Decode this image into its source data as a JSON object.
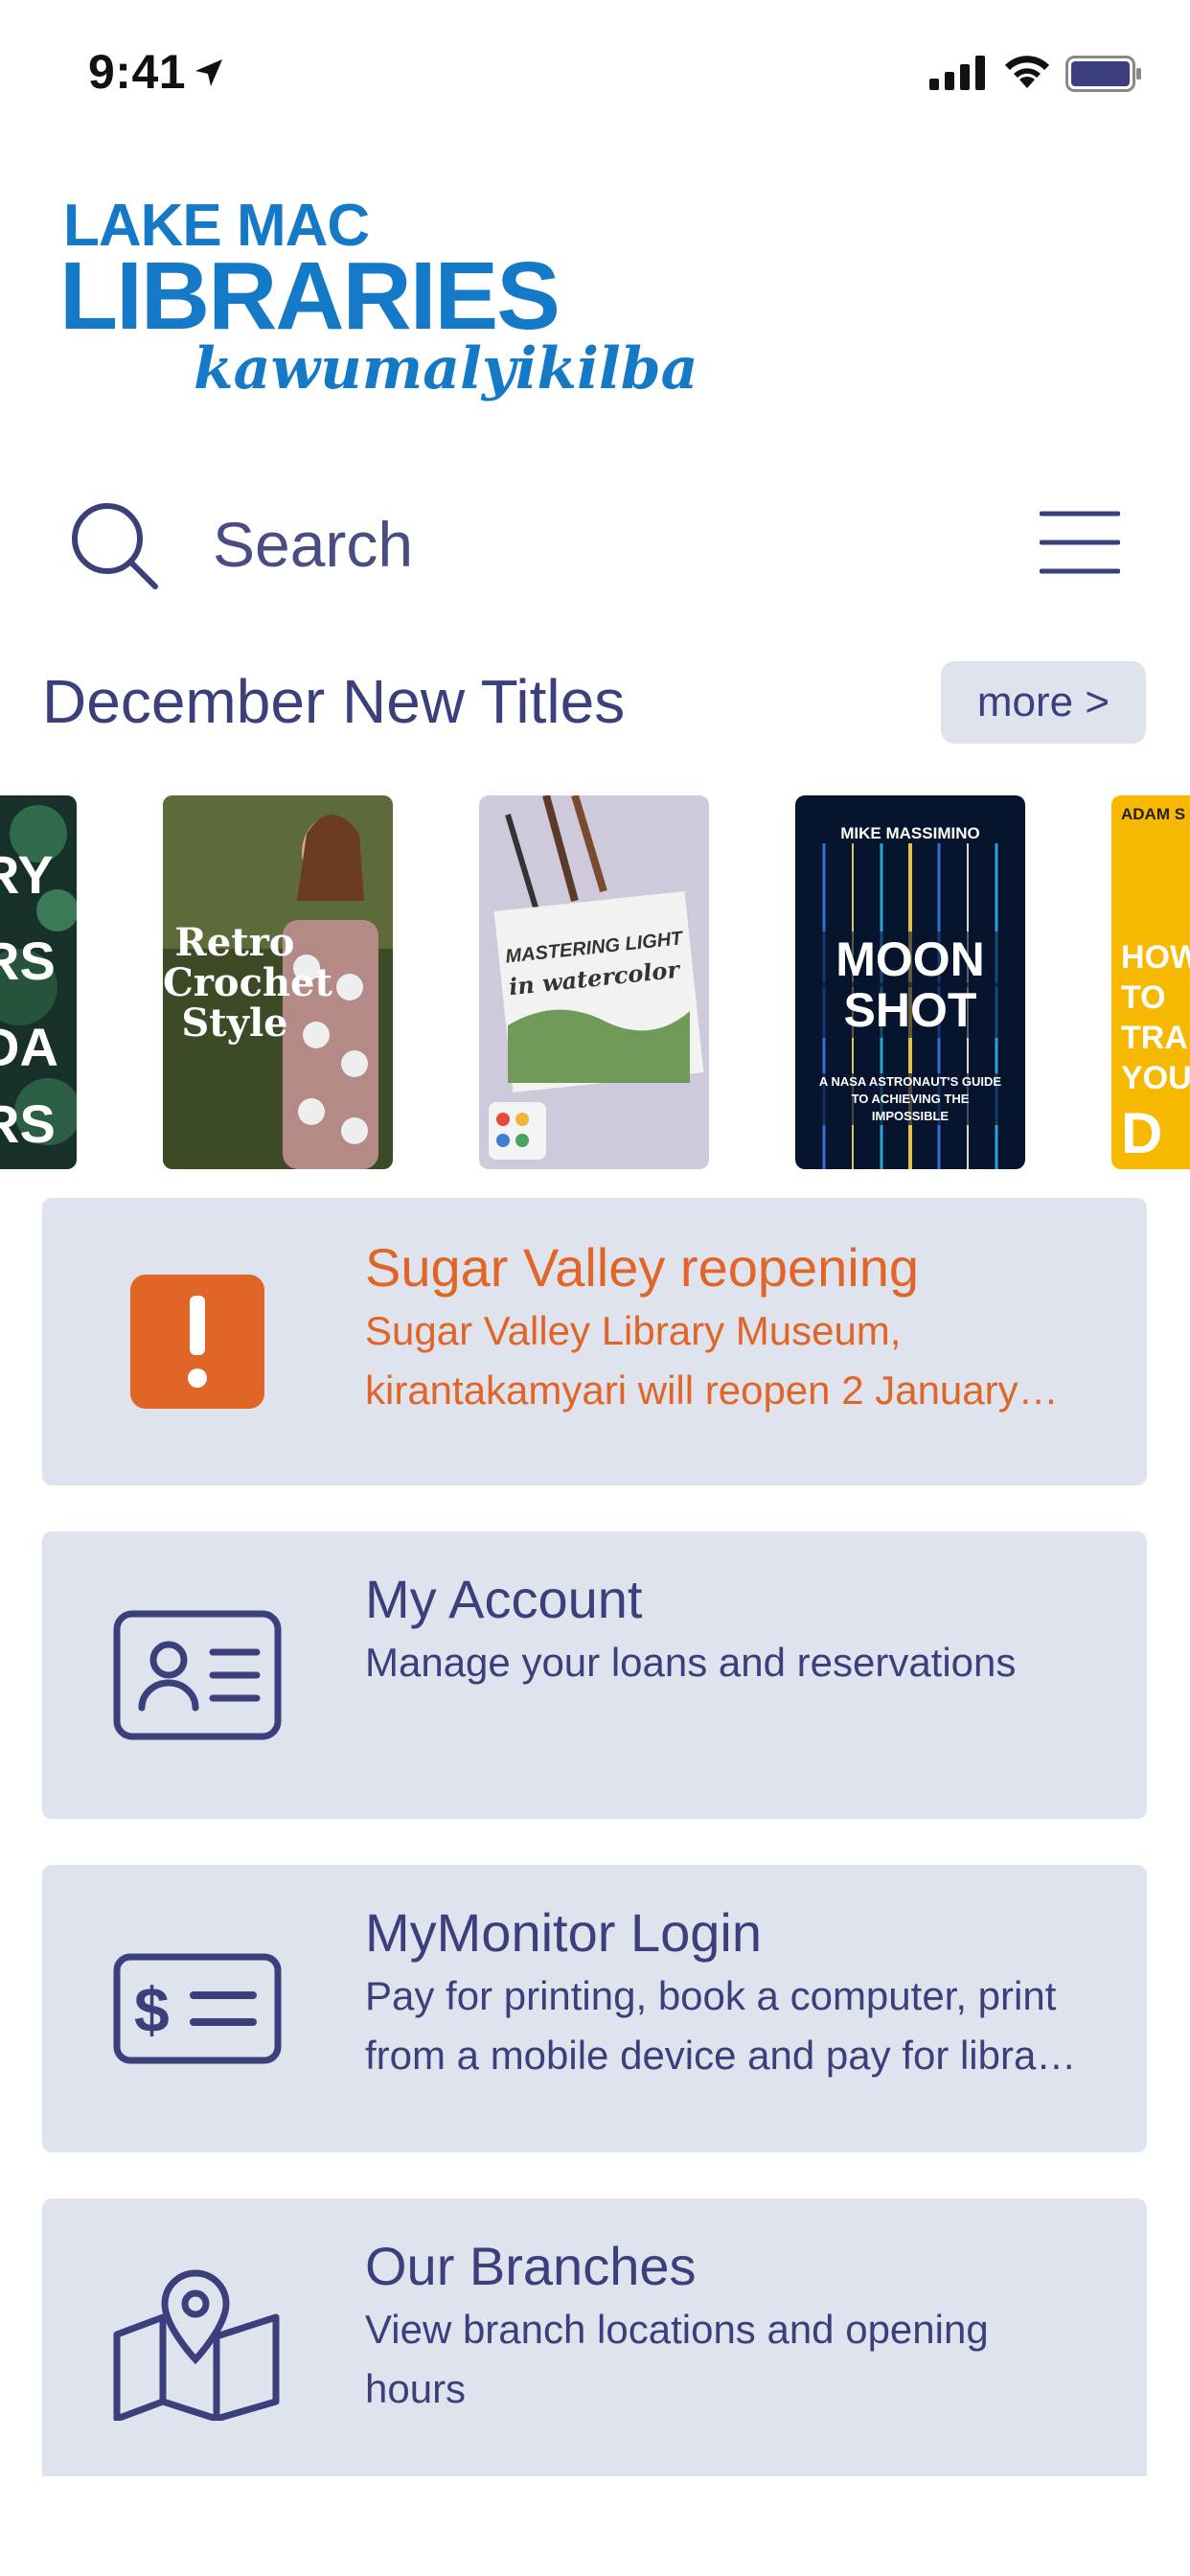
{
  "status_bar": {
    "time": "9:41"
  },
  "logo": {
    "line1": "LAKE MAC",
    "line2": "LIBRARIES",
    "line3": "kawumalyikilba"
  },
  "search": {
    "placeholder": "Search"
  },
  "section": {
    "title": "December New Titles",
    "more_label": "more >"
  },
  "books": [
    {
      "cover_lines": [
        "RY",
        "RS",
        "DA",
        "RS"
      ]
    },
    {
      "cover_lines": [
        "Retro",
        "Crochet",
        "Style"
      ]
    },
    {
      "cover_lines": [
        "MASTERING LIGHT",
        "in watercolor"
      ]
    },
    {
      "author": "MIKE MASSIMINO",
      "cover_lines": [
        "MOON",
        "SHOT"
      ],
      "subtitle": "A NASA ASTRONAUT'S GUIDE TO ACHIEVING THE IMPOSSIBLE"
    },
    {
      "author": "ADAM S",
      "cover_lines": [
        "HOW",
        "TO",
        "TRA",
        "YOU",
        "D"
      ]
    }
  ],
  "cards": {
    "alert": {
      "title": "Sugar Valley reopening",
      "desc_line1": "Sugar Valley Library Museum,",
      "desc_line2": "kirantakamyari will reopen 2 January…"
    },
    "account": {
      "title": "My Account",
      "desc_line1": "Manage your loans and reservations"
    },
    "mymonitor": {
      "title": "MyMonitor Login",
      "desc_line1": "Pay for printing, book a computer, print",
      "desc_line2": "from a mobile device and pay for libra…"
    },
    "branches": {
      "title": "Our Branches",
      "desc_line1": "View branch locations and opening",
      "desc_line2": "hours"
    }
  },
  "colors": {
    "primary": "#3b3f7c",
    "brand_blue": "#1479c7",
    "alert_orange": "#e06526",
    "card_bg": "#dfe3ee"
  }
}
